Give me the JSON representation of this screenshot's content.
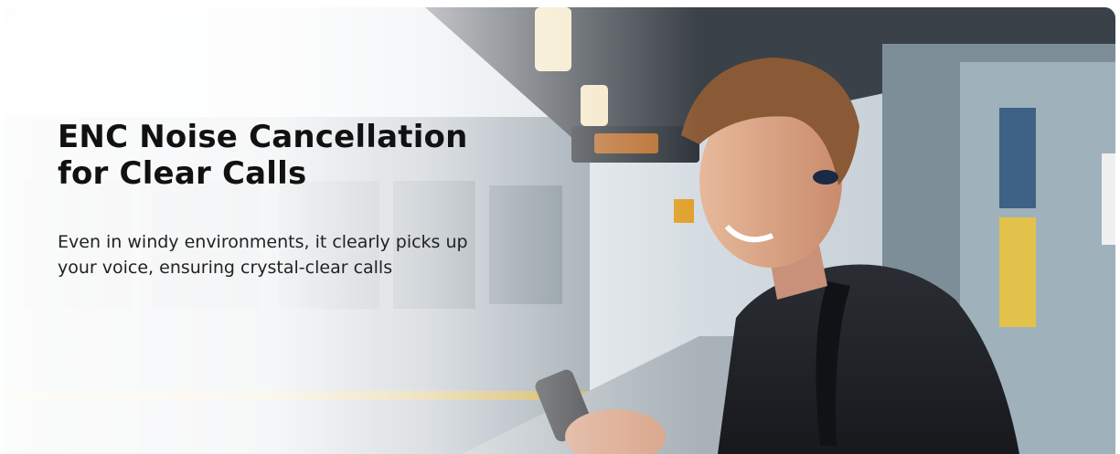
{
  "banner": {
    "headline": "ENC Noise Cancellation\nfor Clear Calls",
    "subline": "Even in windy environments, it clearly picks up\nyour voice, ensuring crystal-clear calls"
  }
}
